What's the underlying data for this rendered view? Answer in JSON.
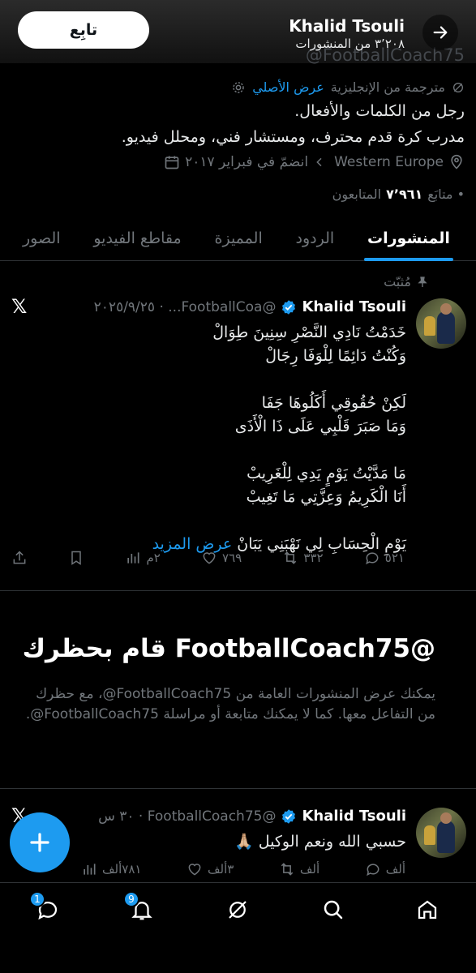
{
  "header": {
    "follow_label": "تابِع",
    "name": "Khalid Tsouli",
    "posts_count": "٣٬٢٠٨ من المنشورات",
    "handle_behind": "@FootballCoach75"
  },
  "profile": {
    "translated_label": "مترجمة من الإنجليزية",
    "show_original": "عرض الأصلي",
    "bio_line1": "رجل من الكلمات والأفعال.",
    "bio_line2": "مدرب كرة قدم محترف، ومستشار فني، ومحلل فيديو.",
    "location": "Western Europe",
    "joined": "انضمّ في فبراير ٢٠١٧",
    "following_label": "• متابَع",
    "followers_count": "٧٬٩٦١",
    "followers_label": "المتابعون"
  },
  "tabs": [
    {
      "label": "المنشورات",
      "active": true
    },
    {
      "label": "الردود",
      "active": false
    },
    {
      "label": "المميزة",
      "active": false
    },
    {
      "label": "مقاطع الفيديو",
      "active": false
    },
    {
      "label": "الصور",
      "active": false
    }
  ],
  "pinned_tweet": {
    "pinned_label": "مُثبّت",
    "name": "Khalid Tsouli",
    "handle_date": "@FootballCoa... · ٢٠٢٥/٩/٢٥",
    "lines": [
      "خَدَمْتُ نَادِي النَّصْرِ سِنِينَ طِوَالْ",
      "وَكُنْتُ دَائِمًا لِلْوَفَا رِجَالْ",
      "",
      "لَكِنْ حُقُوقِي أَكَلُوهَا جَفَا",
      "وَمَا صَبَرَ قَلْبِي عَلَى ذَا الْأَذَى",
      "",
      "مَا مَدَّيْتُ يَوْمٍ يَدِي لِلْغَرِيبْ",
      "أَنَا الْكَرِيمُ وَعِزَّتِي مَا تَغِيبْ"
    ],
    "last_line": "يَوْمِ الْحِسَابِ لِي نَهْبَنِي يَبَانْ",
    "show_more": "عرض المزيد",
    "replies": "٥٢١",
    "reposts": "٣٣٢",
    "likes": "٧٦٩",
    "views": "٢م"
  },
  "blocked": {
    "title": "@FootballCoach75 قام بحظرك",
    "body": "يمكنك عرض المنشورات العامة من ‎@FootballCoach75، مع حظرك من التفاعل معها. كما لا يمكنك متابعة أو مراسلة ‎@FootballCoach75."
  },
  "second_tweet": {
    "name": "Khalid Tsouli",
    "handle_time": "@FootballCoach75 · ٣٠ س",
    "text": "حسبي الله ونعم الوكيل 🙏🏼",
    "replies": "ألف",
    "reposts": "ألف",
    "likes": "٣ألف",
    "views": "٧٨١ألف"
  },
  "nav": {
    "messages_badge": "1",
    "notifications_badge": "9"
  },
  "colors": {
    "accent": "#1d9bf0",
    "background": "#000000",
    "muted": "#71767b"
  }
}
